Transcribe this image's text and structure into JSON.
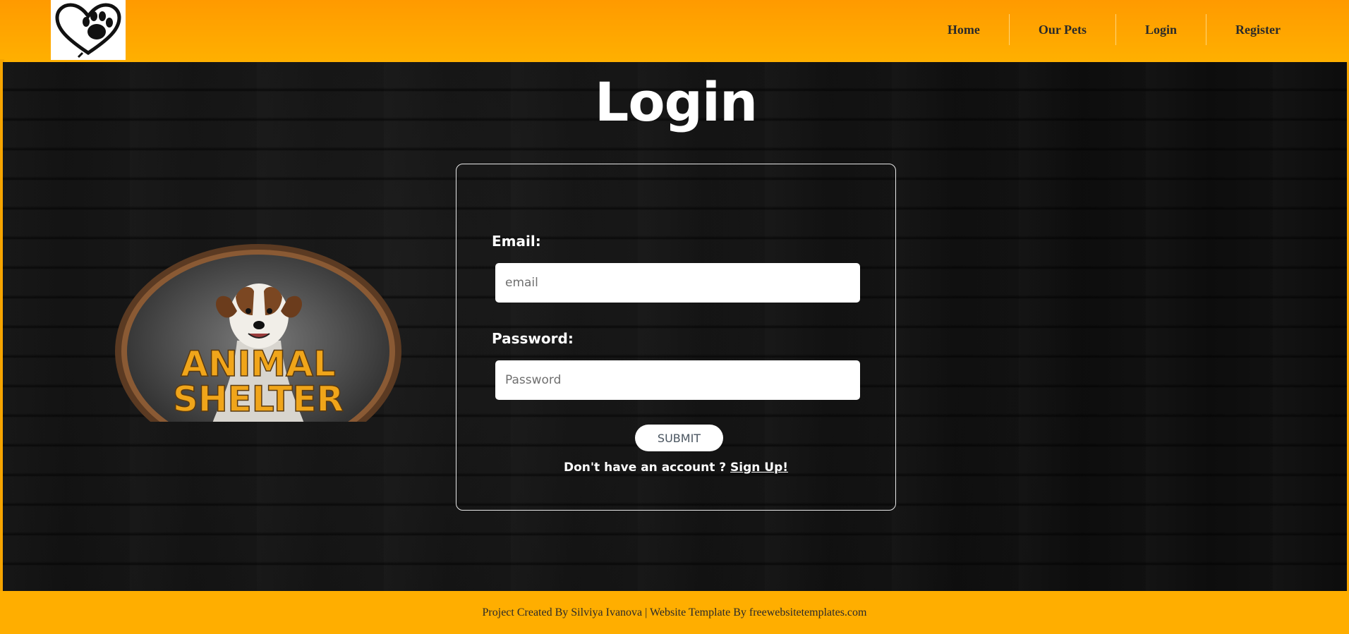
{
  "colors": {
    "header_bg": "#ffa600",
    "main_bg": "#0e0e0e",
    "footer_bg": "#ffae00",
    "text_light": "#ffffff"
  },
  "header": {
    "logo_icon": "heart-paw-icon",
    "nav": [
      {
        "label": "Home"
      },
      {
        "label": "Our Pets"
      },
      {
        "label": "Login"
      },
      {
        "label": "Register"
      }
    ]
  },
  "main": {
    "title": "Login",
    "badge": {
      "icon": "animal-shelter-badge",
      "line1": "ANIMAL",
      "line2": "SHELTER"
    },
    "form": {
      "email_label": "Email:",
      "email_placeholder": "email",
      "email_value": "",
      "password_label": "Password:",
      "password_placeholder": "Password",
      "password_value": "",
      "submit_label": "SUBMIT",
      "signup_prompt": "Don't have an account ?",
      "signup_link": "Sign Up!"
    }
  },
  "footer": {
    "text": "Project Created By Silviya Ivanova | Website Template By freewebsitetemplates.com"
  }
}
